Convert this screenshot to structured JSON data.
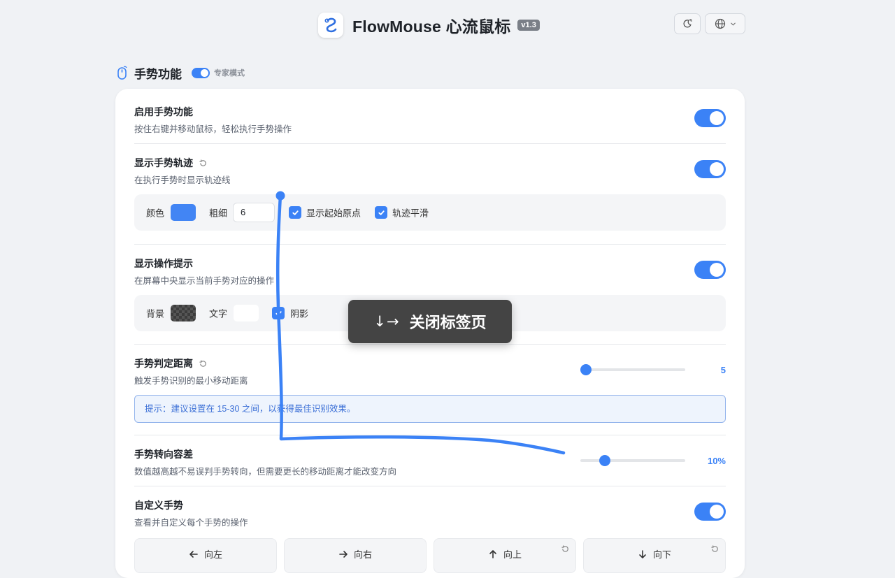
{
  "header": {
    "app_name": "FlowMouse 心流鼠标",
    "version": "v1.3",
    "accent": "#3b82f6"
  },
  "section": {
    "title": "手势功能",
    "expert_mode_label": "专家模式",
    "expert_mode_on": true
  },
  "settings": {
    "enable": {
      "title": "启用手势功能",
      "desc": "按住右键并移动鼠标，轻松执行手势操作",
      "on": true
    },
    "trail": {
      "title": "显示手势轨迹",
      "desc": "在执行手势时显示轨迹线",
      "on": true,
      "color_label": "颜色",
      "color": "#4285f4",
      "width_label": "粗细",
      "width_value": "6",
      "show_origin_label": "显示起始原点",
      "smooth_label": "轨迹平滑"
    },
    "hint": {
      "title": "显示操作提示",
      "desc": "在屏幕中央显示当前手势对应的操作",
      "on": true,
      "bg_label": "背景",
      "text_label": "文字",
      "shadow_label": "阴影"
    },
    "distance": {
      "title": "手势判定距离",
      "desc": "触发手势识别的最小移动距离",
      "value": "5",
      "slider_fraction": 0.05,
      "tip": "提示：建议设置在 15-30 之间，以获得最佳识别效果。"
    },
    "tolerance": {
      "title": "手势转向容差",
      "desc": "数值越高越不易误判手势转向，但需要更长的移动距离才能改变方向",
      "value": "10%",
      "slider_fraction": 0.23
    },
    "custom": {
      "title": "自定义手势",
      "desc": "查看并自定义每个手势的操作",
      "on": true,
      "gestures": [
        {
          "label": "向左",
          "icon": "arrow-left-icon"
        },
        {
          "label": "向右",
          "icon": "arrow-right-icon"
        },
        {
          "label": "向上",
          "icon": "arrow-up-icon"
        },
        {
          "label": "向下",
          "icon": "arrow-down-icon"
        }
      ]
    }
  },
  "overlay": {
    "gesture_arrows": "↓→",
    "action": "关闭标签页"
  }
}
